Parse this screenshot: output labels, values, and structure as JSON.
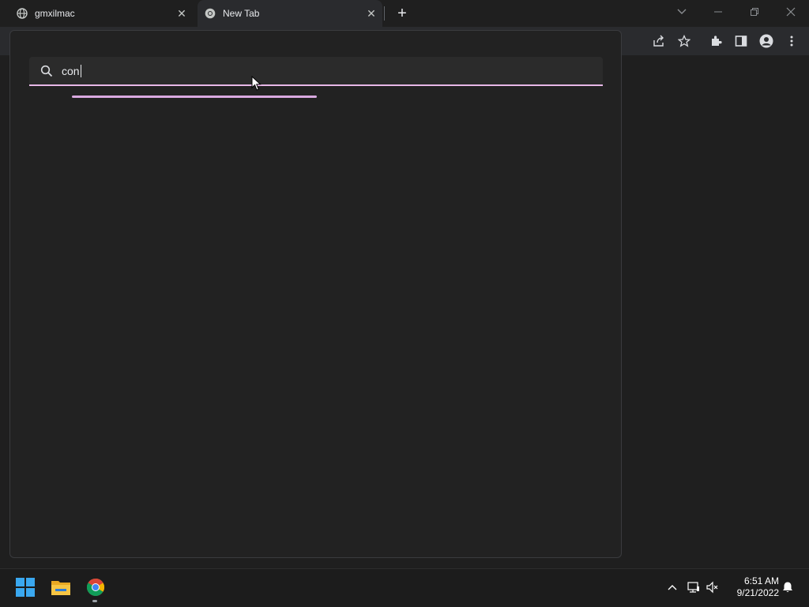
{
  "tabs": [
    {
      "title": "gmxilmac",
      "icon": "globe-icon"
    },
    {
      "title": "New Tab",
      "icon": "chrome-icon"
    }
  ],
  "search": {
    "value": "con",
    "placeholder": ""
  },
  "clock": {
    "time": "6:51 AM",
    "date": "9/21/2022"
  },
  "colors": {
    "accent": "#e8b8e8",
    "background": "#202124",
    "popover": "#222222"
  }
}
